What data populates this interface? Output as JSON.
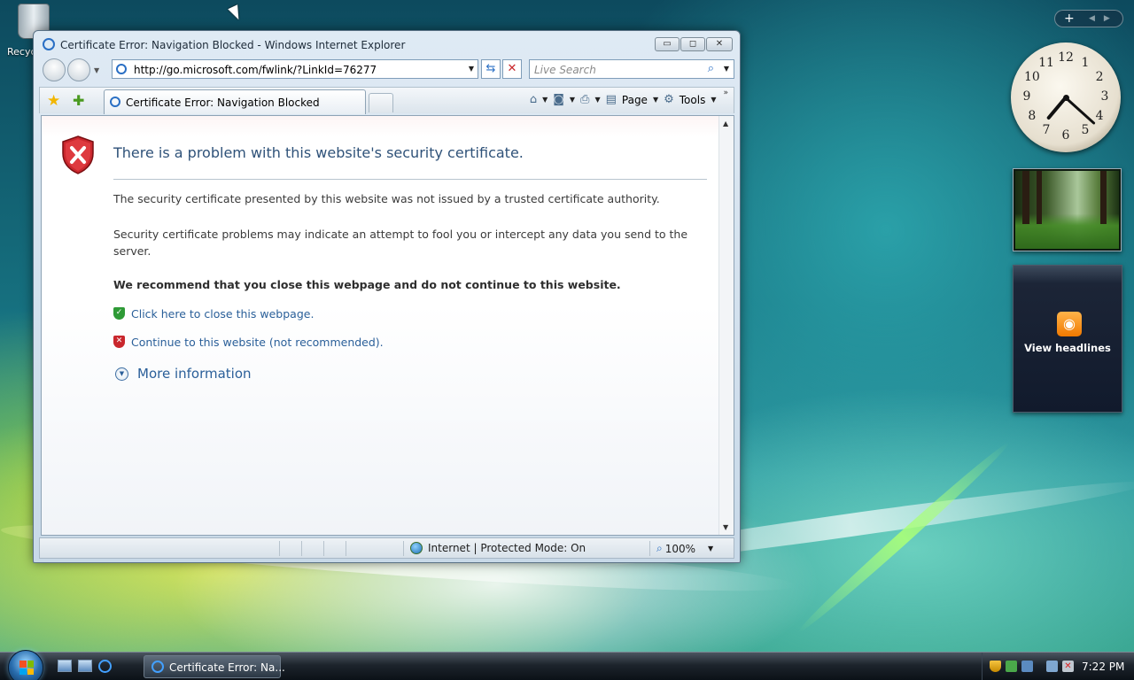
{
  "desktop": {
    "recycle_bin_label": "Recycle Bin"
  },
  "window": {
    "title": "Certificate Error: Navigation Blocked - Windows Internet Explorer",
    "caption_minimize": "▭",
    "caption_maximize": "◻",
    "caption_close": "✕"
  },
  "navbar": {
    "address": "http://go.microsoft.com/fwlink/?LinkId=76277",
    "search_placeholder": "Live Search"
  },
  "tabs": [
    {
      "label": "Certificate Error: Navigation Blocked",
      "active": true
    }
  ],
  "commandbar": {
    "page_label": "Page",
    "tools_label": "Tools"
  },
  "page": {
    "title": "There is a problem with this website's security certificate.",
    "para1": "The security certificate presented by this website was not issued by a trusted certificate authority.",
    "para2": "Security certificate problems may indicate an attempt to fool you or intercept any data you send to the server.",
    "recommend": "We recommend that you close this webpage and do not continue to this website.",
    "close_link": "Click here to close this webpage.",
    "continue_link": "Continue to this website (not recommended).",
    "more_info": "More information"
  },
  "statusbar": {
    "zone": "Internet | Protected Mode: On",
    "zoom": "100%"
  },
  "gadgets": {
    "feed_label": "View headlines"
  },
  "clock_numbers": [
    "12",
    "1",
    "2",
    "3",
    "4",
    "5",
    "6",
    "7",
    "8",
    "9",
    "10",
    "11"
  ],
  "taskbar": {
    "task_label": "Certificate Error: Na...",
    "time": "7:22 PM"
  },
  "colors": {
    "link": "#2a5f99",
    "title": "#2f5279",
    "error_red": "#c9272d",
    "ok_green": "#2e9a36"
  }
}
